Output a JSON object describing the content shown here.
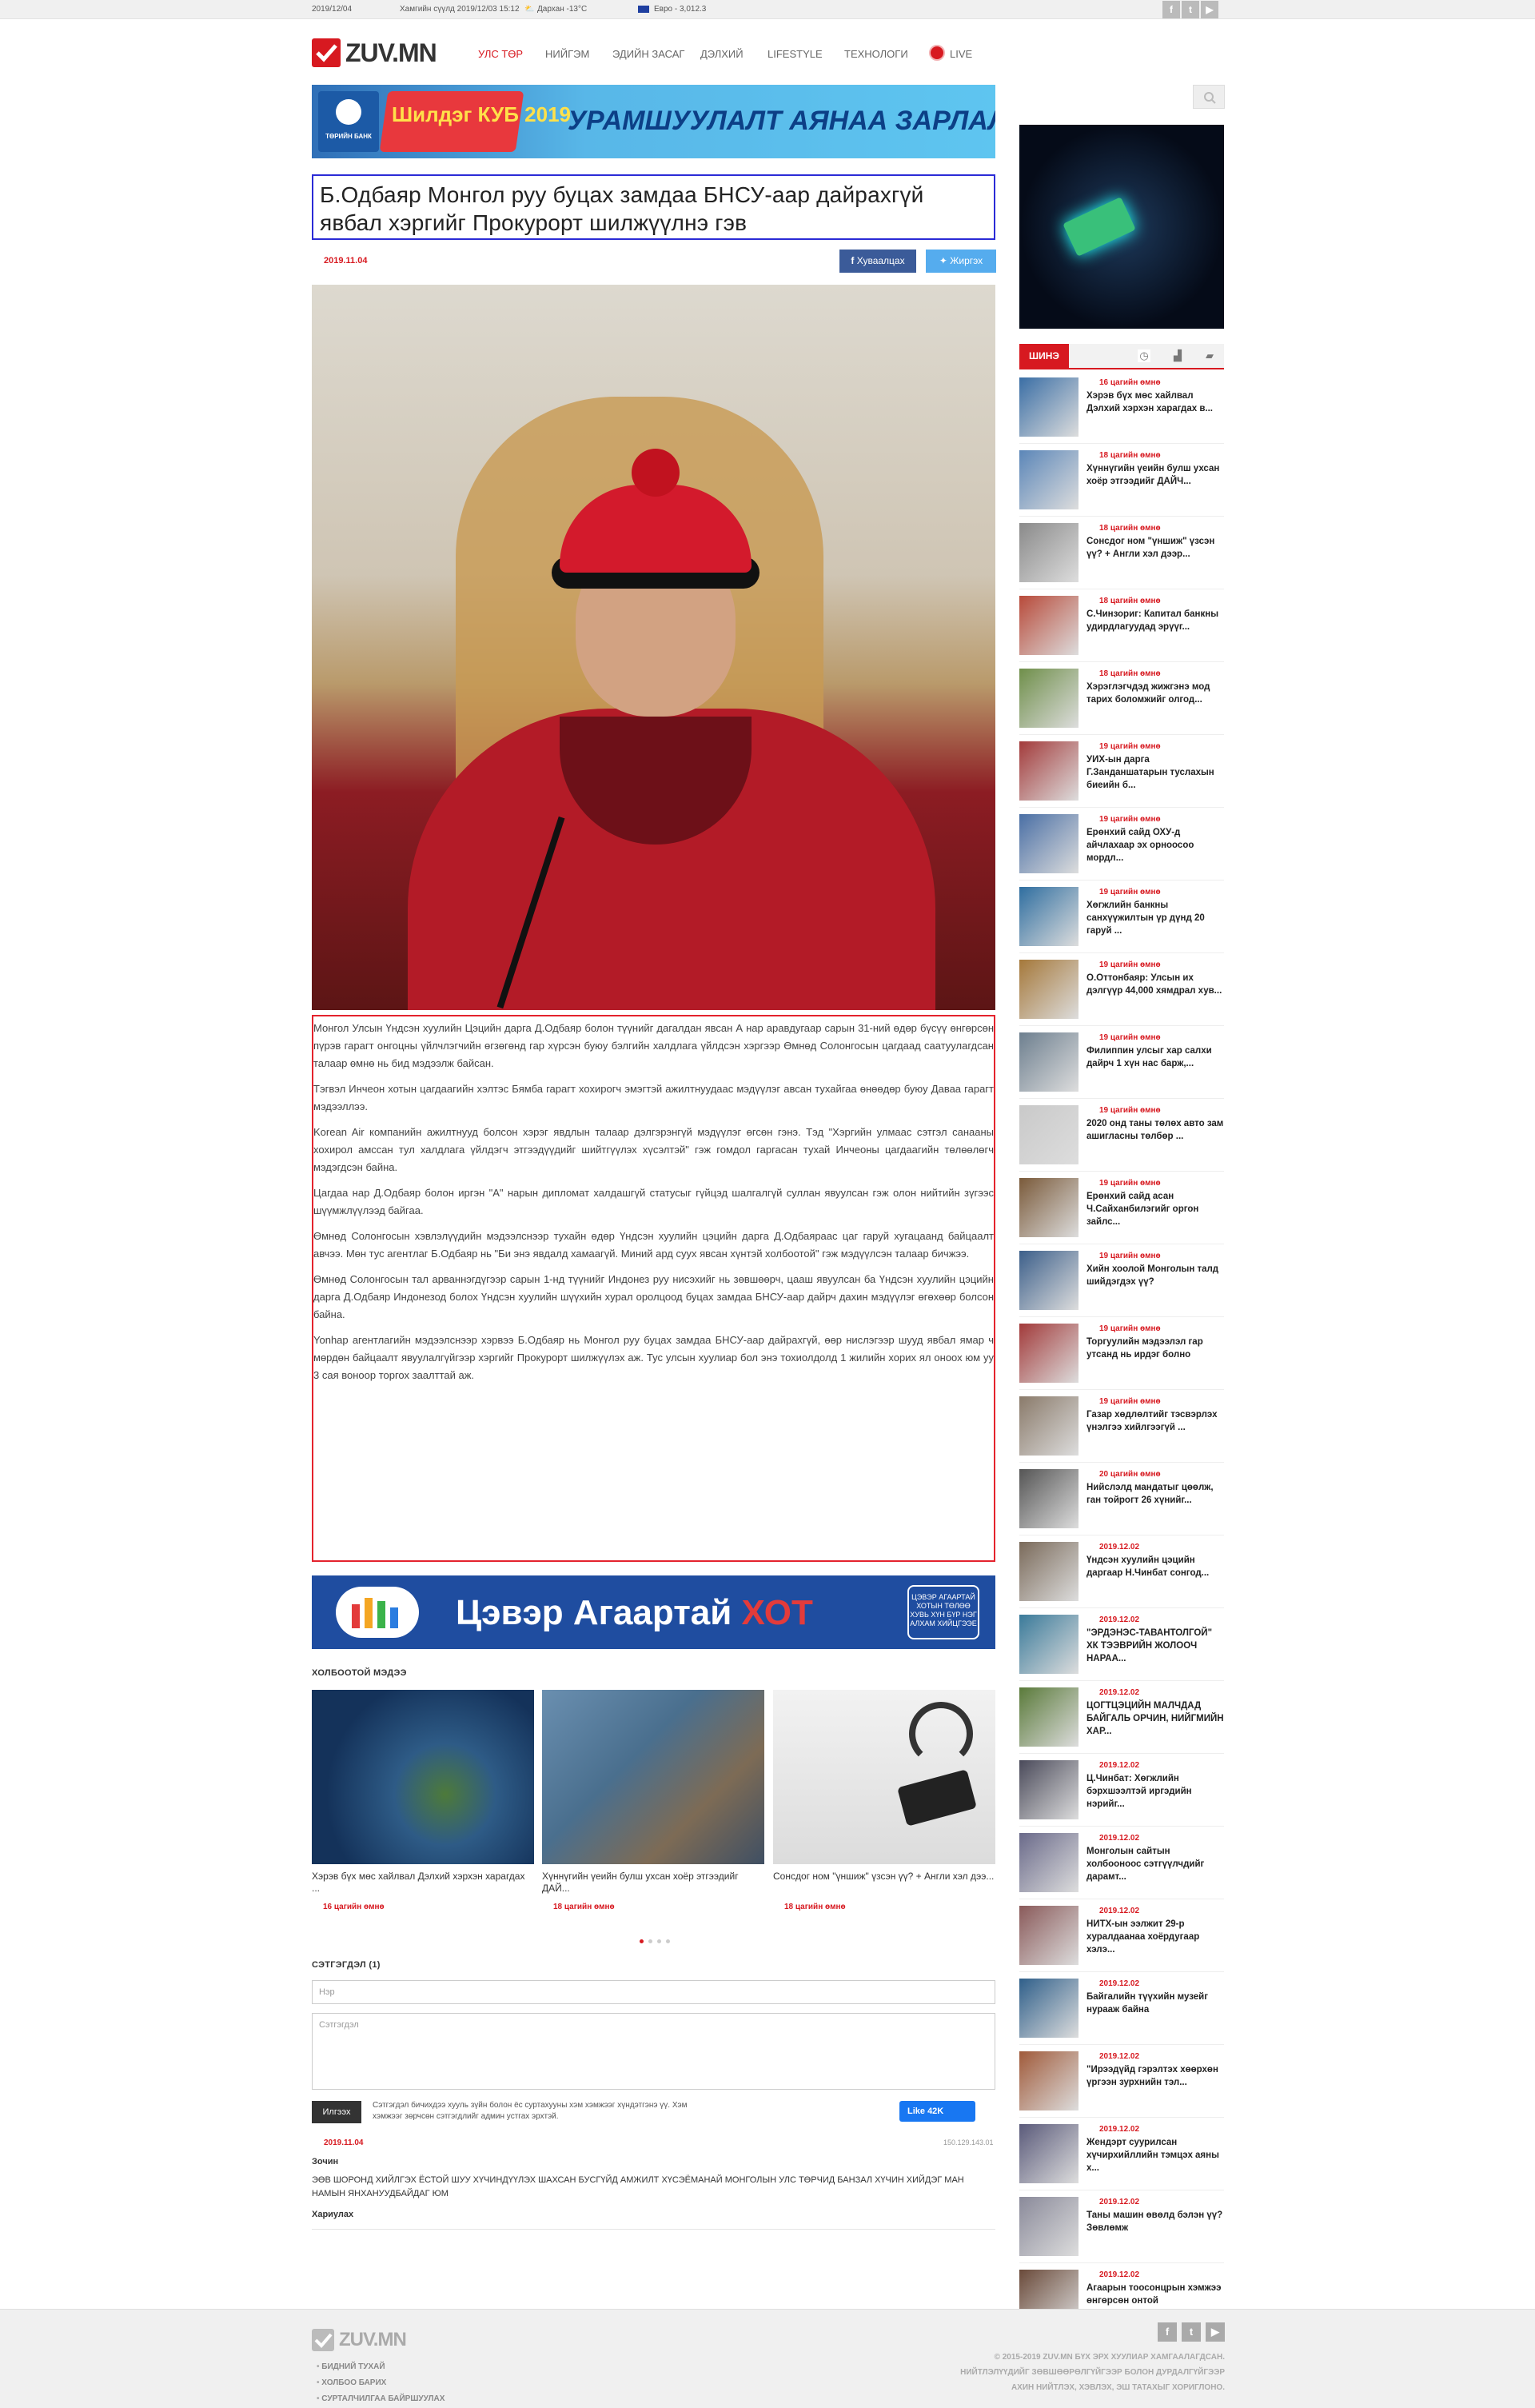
{
  "topbar": {
    "date": "2019/12/04",
    "weather_date": "Хамгийн сүүлд 2019/12/03 15:12",
    "city_weather": "Дархан -13°C",
    "currency": "Евро - 3,012.3"
  },
  "site": {
    "logo": "ZUV.MN"
  },
  "nav": [
    "УЛС ТӨР",
    "НИЙГЭМ",
    "ЭДИЙН ЗАСАГ",
    "ДЭЛХИЙ",
    "LIFESTYLE",
    "ТЕХНОЛОГИ",
    "LIVE"
  ],
  "banner1": {
    "bank": "ТӨРИЙН БАНК",
    "promo": "Шилдэг КУБ 2019",
    "text": "УРАМШУУЛАЛТ АЯНАА ЗАРЛАЛАА"
  },
  "article": {
    "title": "Б.Одбаяр Монгол руу буцах замдаа БНСУ-аар дайрахгүй явбал хэргийг Прокурорт шилжүүлнэ гэв",
    "date": "2019.11.04",
    "share_fb": "Хуваалцах",
    "share_tw": "Жиргэх",
    "paragraphs": [
      "Монгол Улсын Үндсэн хуулийн Цэцийн дарга Д.Одбаяр болон түүнийг дагалдан явсан А нар аравдугаар сарын 31-ний өдөр бүсүү өнгөрсөн пүрэв гарагт онгоцны үйлчлэгчийн өгзөгөнд гар хүрсэн буюу бэлгийн халдлага үйлдсэн хэргээр Өмнөд Солонгосын цагдаад саатуулагдсан талаар өмнө нь бид мэдээлж байсан.",
      "Тэгвэл Инчеон хотын цагдаагийн хэлтэс Бямба гарагт хохирогч эмэгтэй ажилтнуудаас мэдүүлэг авсан тухайгаа өнөөдөр буюу Даваа гарагт мэдээллээ.",
      "Korean Air компанийн ажилтнууд болсон хэрэг явдлын талаар дэлгэрэнгүй мэдүүлэг өгсөн гэнэ. Тэд \"Хэргийн улмаас сэтгэл санааны хохирол амссан тул халдлага үйлдэгч этгээдүүдийг шийтгүүлэх хүсэлтэй\" гэж гомдол гаргасан тухай Инчеоны цагдаагийн төлөөлөгч мэдэгдсэн байна.",
      "Цагдаа нар Д.Одбаяр болон иргэн \"А\" нарын дипломат халдашгүй статусыг гүйцэд шалгалгүй суллан явуулсан гэж олон нийтийн зүгээс шүүмжлүүлээд байгаа.",
      "Өмнөд Солонгосын хэвлэлүүдийн мэдээлснээр тухайн өдөр Үндсэн хуулийн цэцийн дарга Д.Одбаяраас цаг гаруй хугацаанд байцаалт авчээ. Мөн тус агентлаг Б.Одбаяр нь \"Би энэ явдалд хамаагүй. Миний ард суух явсан хүнтэй холбоотой\" гэж мэдүүлсэн талаар бичжээ.",
      "Өмнөд Солонгосын тал арваннэгдүгээр сарын 1-нд түүнийг Индонез руу нисэхийг нь зөвшөөрч, цааш явуулсан ба Үндсэн хуулийн цэцийн дарга Д.Одбаяр Индонезод болох Үндсэн хуулийн шүүхийн хурал оролцоод буцах замдаа БНСУ-аар дайрч дахин мэдүүлэг өгөхөөр болсон байна.",
      "Yonhap агентлагийн мэдээлснээр хэрвээ Б.Одбаяр нь Монгол руу буцах замдаа БНСУ-аар дайрахгүй, өөр нислэгээр шууд явбал ямар ч мөрдөн байцаалт явуулалгүйгээр хэргийг Прокурорт шилжүүлэх аж. Тус улсын хуулиар бол энэ тохиолдолд 1 жилийн хорих ял оноох юм уу 3 сая воноор торгох заалттай аж."
    ]
  },
  "banner2": {
    "text1": "Цэвэр Агаартай ",
    "text2": "ХОТ",
    "badge": "ЦЭВЭР АГААРТАЙ ХОТЫН ТӨЛӨӨ ХУВЬ ХҮН БҮР НЭГ АЛХАМ ХИЙЦГЭЭЕ"
  },
  "related": {
    "title": "ХОЛБООТОЙ МЭДЭЭ",
    "items": [
      {
        "title": "Хэрэв бүх мөс хайлвал Дэлхий хэрхэн харагдах ...",
        "time": "16 цагийн өмнө"
      },
      {
        "title": "Хүннүгийн үеийн булш ухсан хоёр этгээдийг ДАЙ...",
        "time": "18 цагийн өмнө"
      },
      {
        "title": "Сонсдог ном \"үншиж\" үзсэн үү? + Англи хэл дээ...",
        "time": "18 цагийн өмнө"
      }
    ]
  },
  "comments": {
    "title": "СЭТГЭГДЭЛ (1)",
    "name_placeholder": "Нэр",
    "comment_placeholder": "Сэтгэгдэл",
    "send": "Илгээх",
    "note": "Сэтгэгдэл бичихдээ хууль зүйн болон ёс суртахууны хэм хэмжээг хүндэтгэнэ үү. Хэм хэмжээг зөрчсөн сэтгэгдлийг админ устгах эрхтэй.",
    "like": "Like 42K",
    "ip": "150.129.143.01",
    "items": [
      {
        "date": "2019.11.04",
        "author": "Зочин",
        "text": "ЭӨВ ШОРОНД ХИЙЛГЭХ ЁСТОЙ ШУУ ХҮЧИНДҮҮЛЭХ ШАХСАН БУСГҮЙД АМЖИЛТ ХҮСЭЁМАНАЙ МОНГОЛЫН УЛС ТӨРЧИД БАНЗАЛ ХҮЧИН ХИЙДЭГ МАН НАМЫН ЯНХАНУУДБАЙДАГ ЮМ",
        "reply": "Хариулах"
      }
    ]
  },
  "sidebar": {
    "tab_new": "ШИНЭ",
    "items": [
      {
        "time": "16 цагийн өмнө",
        "title": "Хэрэв бүх мөс хайлвал Дэлхий хэрхэн харагдах в..."
      },
      {
        "time": "18 цагийн өмнө",
        "title": "Хүннүгийн үеийн булш ухсан хоёр этгээдийг ДАЙЧ..."
      },
      {
        "time": "18 цагийн өмнө",
        "title": "Сонсдог ном \"үншиж\" үзсэн үү? + Англи хэл дээр..."
      },
      {
        "time": "18 цагийн өмнө",
        "title": "С.Чинзориг: Капитал банкны удирдлагуудад эрүүг..."
      },
      {
        "time": "18 цагийн өмнө",
        "title": "Хэрэглэгчдэд жижгэнэ мод тарих боломжийг олгод..."
      },
      {
        "time": "19 цагийн өмнө",
        "title": "УИХ-ын дарга Г.Занданшатарын туслахын биеийн б..."
      },
      {
        "time": "19 цагийн өмнө",
        "title": "Ерөнхий сайд ОХУ-д айчлахаар эх орноосоо мордл..."
      },
      {
        "time": "19 цагийн өмнө",
        "title": "Хөгжлийн банкны санхүүжилтын үр дүнд 20 гаруй ..."
      },
      {
        "time": "19 цагийн өмнө",
        "title": "О.Оттонбаяр: Улсын их дэлгүүр 44,000 хямдрал хув..."
      },
      {
        "time": "19 цагийн өмнө",
        "title": "Филиппин улсыг хар салхи дайрч 1 хүн нас барж,..."
      },
      {
        "time": "19 цагийн өмнө",
        "title": "2020 онд таны төлөх авто зам ашигласны төлбөр ..."
      },
      {
        "time": "19 цагийн өмнө",
        "title": "Ерөнхий сайд асан Ч.Сайханбилэгийг оргон зайлс..."
      },
      {
        "time": "19 цагийн өмнө",
        "title": "Хийн хоолой Монголын талд шийдэгдэх үү?"
      },
      {
        "time": "19 цагийн өмнө",
        "title": "Торгуулийн мэдээлэл гар утсанд нь ирдэг болно"
      },
      {
        "time": "19 цагийн өмнө",
        "title": "Газар хөдлөлтийг тэсвэрлэх үнэлгээ хийлгээгүй ..."
      },
      {
        "time": "20 цагийн өмнө",
        "title": "Нийслэлд мандатыг цөөлж, ган тойрогт 26 хүнийг..."
      },
      {
        "time": "2019.12.02",
        "title": "Үндсэн хуулийн цэцийн даргаар Н.Чинбат сонгод..."
      },
      {
        "time": "2019.12.02",
        "title": "\"ЭРДЭНЭС-ТАВАНТОЛГОЙ\" ХК ТЭЭВРИЙН ЖОЛООЧ НАРАА..."
      },
      {
        "time": "2019.12.02",
        "title": "ЦОГТЦЭЦИЙН МАЛЧДАД БАЙГАЛЬ ОРЧИН, НИЙГМИЙН ХАР..."
      },
      {
        "time": "2019.12.02",
        "title": "Ц.Чинбат: Хөгжлийн бэрхшээлтэй иргэдийн нэрийг..."
      },
      {
        "time": "2019.12.02",
        "title": "Монголын сайтын холбооноос сэтгүүлчдийг дарамт..."
      },
      {
        "time": "2019.12.02",
        "title": "НИТХ-ын ээлжит 29-р хуралдаанаа хоёрдугаар хэлэ..."
      },
      {
        "time": "2019.12.02",
        "title": "Байгалийн түүхийн музейг нурааж байна"
      },
      {
        "time": "2019.12.02",
        "title": "\"Ирээдүйд гэрэлтэх хөөрхөн үргээн зурхнийн тэл..."
      },
      {
        "time": "2019.12.02",
        "title": "Жендэрт суурилсан хүчирхийллийн тэмцэх аяны х..."
      },
      {
        "time": "2019.12.02",
        "title": "Таны машин өвөлд бэлэн үү? Зөвлөмж"
      },
      {
        "time": "2019.12.02",
        "title": "Агаарын тоосонцрын хэмжээ өнгөрсөн онтой"
      }
    ]
  },
  "footer": {
    "logo": "ZUV.MN",
    "links": [
      "БИДНИЙ ТУХАЙ",
      "ХОЛБОО БАРИХ",
      "СУРТАЛЧИЛГАА БАЙРШУУЛАХ"
    ],
    "copy": [
      "© 2015-2019 ZUV.MN БҮХ ЭРХ ХУУЛИАР ХАМГААЛАГДСАН.",
      "НИЙТЛЭЛҮҮДИЙГ ЗӨВШӨӨРӨЛГҮЙГЭЭР БОЛОН ДУРДАЛГҮЙГЭЭР",
      "АХИН НИЙТЛЭХ, ХЭВЛЭХ, ЭШ ТАТАХЫГ ХОРИГЛОНО."
    ]
  }
}
